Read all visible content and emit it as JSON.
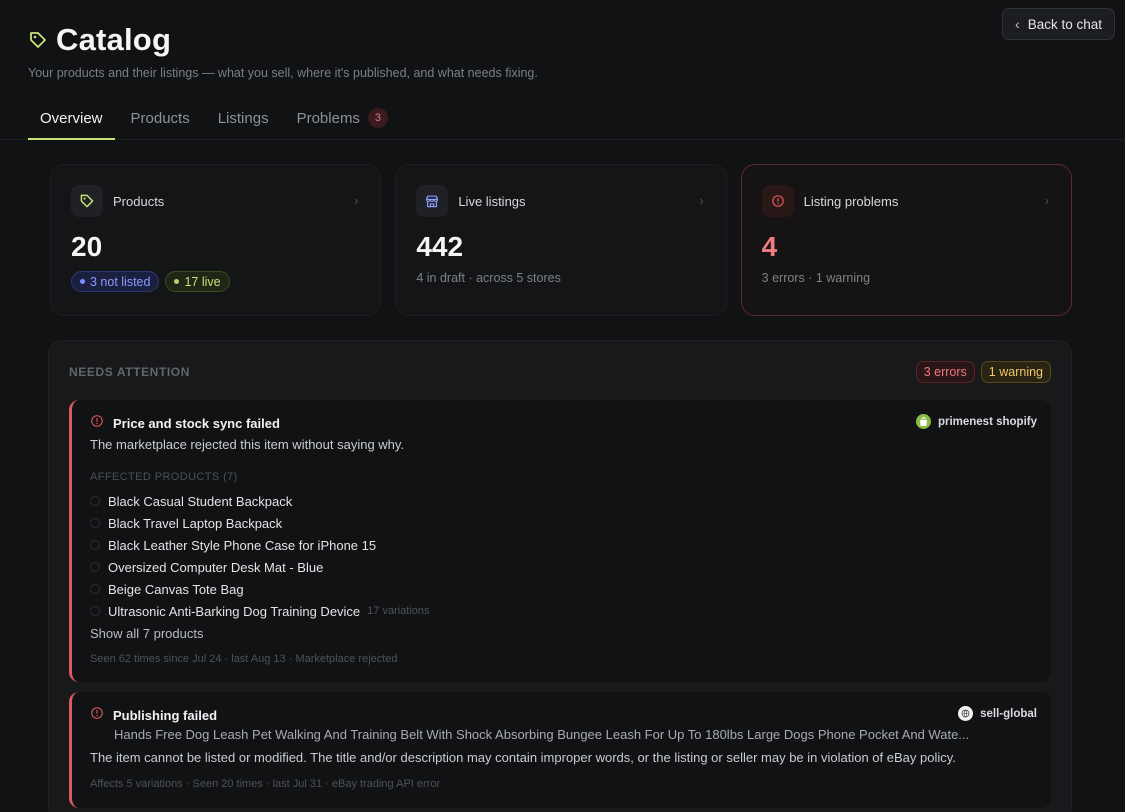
{
  "header": {
    "title": "Catalog",
    "subtitle": "Your products and their listings — what you sell, where it's published, and what needs fixing.",
    "back_label": "Back to chat"
  },
  "tabs": [
    {
      "label": "Overview",
      "active": true
    },
    {
      "label": "Products"
    },
    {
      "label": "Listings"
    },
    {
      "label": "Problems",
      "badge": "3"
    }
  ],
  "cards": {
    "products": {
      "label": "Products",
      "value": "20",
      "pill_not_listed": "3 not listed",
      "pill_live": "17 live"
    },
    "live": {
      "label": "Live listings",
      "value": "442",
      "sub": "4 in draft · across 5 stores"
    },
    "problems": {
      "label": "Listing problems",
      "value": "4",
      "sub": "3 errors · 1 warning"
    }
  },
  "attention": {
    "title": "NEEDS ATTENTION",
    "errors_badge": "3 errors",
    "warning_badge": "1 warning",
    "issues": [
      {
        "title": "Price and stock sync failed",
        "store": "primenest shopify",
        "description": "The marketplace rejected this item without saying why.",
        "affected_title": "AFFECTED PRODUCTS (7)",
        "products": [
          {
            "name": "Black Casual Student Backpack"
          },
          {
            "name": "Black Travel Laptop Backpack"
          },
          {
            "name": "Black Leather Style Phone Case for iPhone 15"
          },
          {
            "name": "Oversized Computer Desk Mat - Blue"
          },
          {
            "name": "Beige Canvas Tote Bag"
          },
          {
            "name": "Ultrasonic Anti-Barking Dog Training Device",
            "variations": "17 variations"
          }
        ],
        "show_all": "Show all 7 products",
        "meta": "Seen 62 times since Jul 24 · last Aug 13 · Marketplace rejected"
      },
      {
        "title": "Publishing failed",
        "store": "sell-global",
        "product": "Hands Free Dog Leash Pet Walking And Training Belt With Shock Absorbing Bungee Leash For Up To 180lbs Large Dogs Phone Pocket And Wate...",
        "description": "The item cannot be listed or modified. The title and/or description may contain improper words, or the listing or seller may be in violation of eBay policy.",
        "meta": "Affects 5 variations · Seen 20 times · last Jul 31 · eBay trading API error"
      }
    ]
  },
  "colors": {
    "accent": "#c9e37a",
    "error": "#e0575c",
    "warning": "#f0c76a"
  }
}
